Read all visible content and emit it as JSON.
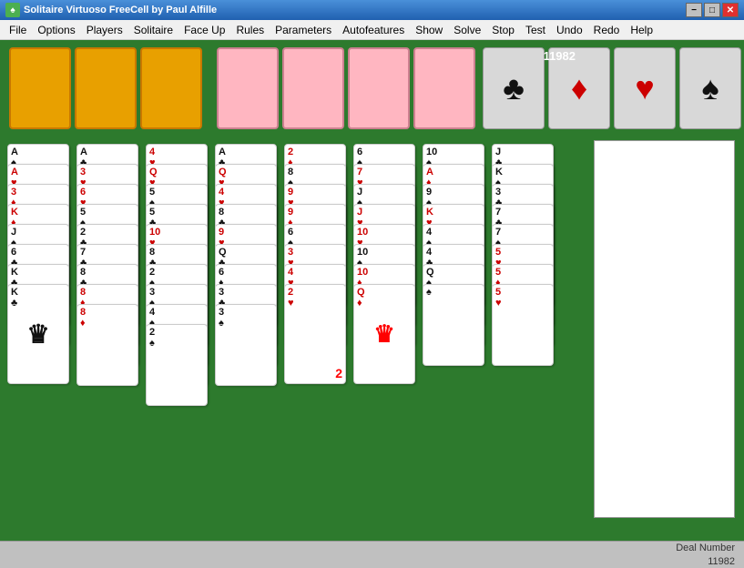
{
  "titleBar": {
    "icon": "♠",
    "title": "Solitaire Virtuoso   FreeCell   by Paul Alfille",
    "minimizeLabel": "−",
    "maximizeLabel": "□",
    "closeLabel": "✕"
  },
  "menuBar": {
    "items": [
      "File",
      "Options",
      "Players",
      "Solitaire",
      "Face Up",
      "Rules",
      "Parameters",
      "Autofeatures",
      "Show",
      "Solve",
      "Stop",
      "Test",
      "Undo",
      "Redo",
      "Help"
    ]
  },
  "gameArea": {
    "score": "11982",
    "suits": [
      {
        "name": "clubs",
        "symbol": "♣"
      },
      {
        "name": "diamonds",
        "symbol": "♦"
      },
      {
        "name": "hearts",
        "symbol": "♥"
      },
      {
        "name": "spades",
        "symbol": "♠"
      }
    ],
    "statusBar": {
      "label": "Deal Number",
      "value": "11982"
    }
  }
}
